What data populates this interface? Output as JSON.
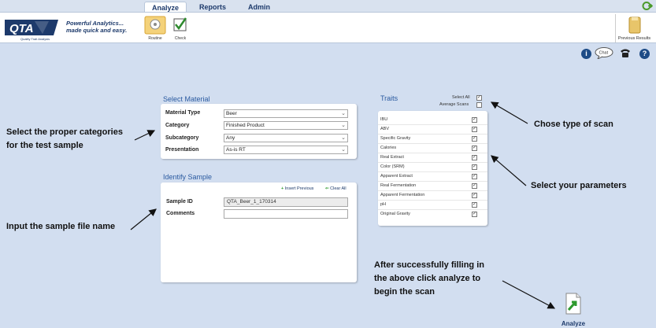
{
  "tabs": [
    {
      "label": "Analyze",
      "active": true
    },
    {
      "label": "Reports",
      "active": false
    },
    {
      "label": "Admin",
      "active": false
    }
  ],
  "brand": {
    "logo_text": "QTA",
    "logo_subtext": "Quality Trait Analysis",
    "tagline_line1": "Powerful Analytics...",
    "tagline_line2": "made quick and easy.",
    "color": "#1d3a6b"
  },
  "toolbar": {
    "routine_label": "Routine",
    "check_label": "Check",
    "previous_results_label": "Previous Results"
  },
  "help_icons": [
    "info-icon",
    "chat-icon",
    "phone-icon",
    "help-icon"
  ],
  "help": {
    "chat_label": "Chat"
  },
  "select_material": {
    "title": "Select Material",
    "fields": [
      {
        "label": "Material Type",
        "value": "Beer"
      },
      {
        "label": "Category",
        "value": "Finished Product"
      },
      {
        "label": "Subcategory",
        "value": "Any"
      },
      {
        "label": "Presentation",
        "value": "As-is RT"
      }
    ]
  },
  "identify_sample": {
    "title": "Identify Sample",
    "insert_previous_label": "Insert Previous",
    "clear_all_label": "Clear All",
    "sample_id_label": "Sample ID",
    "sample_id_value": "QTA_Beer_1_170314",
    "comments_label": "Comments",
    "comments_value": ""
  },
  "traits": {
    "title": "Traits",
    "select_all_label": "Select All",
    "select_all_checked": true,
    "average_scans_label": "Average Scans",
    "average_scans_checked": false,
    "items": [
      {
        "name": "IBU",
        "checked": true
      },
      {
        "name": "ABV",
        "checked": true
      },
      {
        "name": "Specific Gravity",
        "checked": true
      },
      {
        "name": "Calories",
        "checked": true
      },
      {
        "name": "Real Extract",
        "checked": true
      },
      {
        "name": "Color (SRM)",
        "checked": true
      },
      {
        "name": "Apparent Extract",
        "checked": true
      },
      {
        "name": "Real Fermentation",
        "checked": true
      },
      {
        "name": "Apparent Fermentation",
        "checked": true
      },
      {
        "name": "pH",
        "checked": true
      },
      {
        "name": "Original Gravity",
        "checked": true
      }
    ]
  },
  "annotations": {
    "categories_line1": "Select the proper categories",
    "categories_line2": "for the test sample",
    "sample_name": "Input the sample file name",
    "scan_type": "Chose type of scan",
    "parameters": "Select your parameters",
    "analyze_line1": "After successfully filling in",
    "analyze_line2": "the above click analyze to",
    "analyze_line3": "begin the scan"
  },
  "analyze_button_label": "Analyze"
}
